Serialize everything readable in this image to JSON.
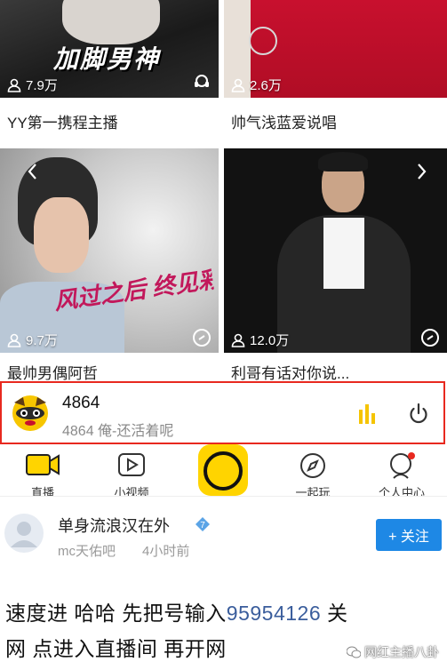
{
  "cards": [
    {
      "viewers": "7.9万",
      "title": "YY第一携程主播",
      "overlay_text": "加脚男神"
    },
    {
      "viewers": "2.6万",
      "title": "帅气浅蓝爱说唱"
    },
    {
      "viewers": "9.7万",
      "title": "最帅男偶阿哲",
      "overlay_text": "风过之后 终见彩虹"
    },
    {
      "viewers": "12.0万",
      "title": "利哥有话对你说..."
    }
  ],
  "player": {
    "title": "4864",
    "subtitle": "4864 俺-还活着呢",
    "highlight_color": "#e8291f"
  },
  "tabbar": {
    "items": [
      {
        "label": "直播",
        "icon": "live-camera-icon"
      },
      {
        "label": "小视频",
        "icon": "video-play-icon"
      },
      {
        "label": "",
        "icon": "center-circle-icon"
      },
      {
        "label": "一起玩",
        "icon": "compass-icon"
      },
      {
        "label": "个人中心",
        "icon": "profile-icon"
      }
    ]
  },
  "post": {
    "author": "单身流浪汉在外",
    "source": "mc天佑吧",
    "time": "4小时前",
    "follow_label": "+ 关注",
    "line1_before": "速度进 哈哈 先把号输入",
    "line1_number": "95954126",
    "line1_after": " 关",
    "line2": "网 点进入直播间 再开网"
  },
  "watermark": "网红主播八卦",
  "colors": {
    "accent_yellow": "#ffd400",
    "follow_blue": "#1e88e5"
  }
}
